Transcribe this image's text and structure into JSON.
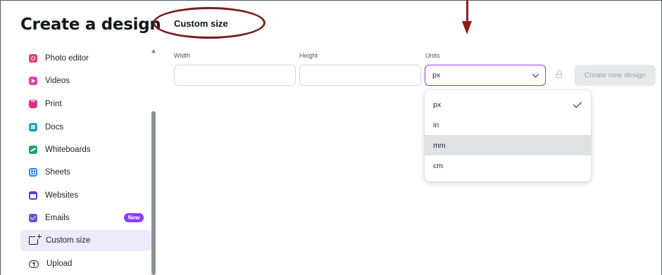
{
  "page": {
    "title": "Create a design"
  },
  "sidebar": {
    "items": [
      {
        "label": "Photo editor",
        "icon": "photo-editor-icon",
        "color": "#e8386f"
      },
      {
        "label": "Videos",
        "icon": "video-icon",
        "color": "#e43ea8"
      },
      {
        "label": "Print",
        "icon": "print-icon",
        "color": "#d8337d"
      },
      {
        "label": "Docs",
        "icon": "docs-icon",
        "color": "#1aa3b5"
      },
      {
        "label": "Whiteboards",
        "icon": "whiteboard-icon",
        "color": "#17a55f"
      },
      {
        "label": "Sheets",
        "icon": "sheets-icon",
        "color": "#2f83e6"
      },
      {
        "label": "Websites",
        "icon": "websites-icon",
        "color": "#5a3fd6"
      },
      {
        "label": "Emails",
        "icon": "email-icon",
        "color": "#5d5bd8",
        "badge": "New"
      },
      {
        "label": "Custom size",
        "icon": "custom-size-icon",
        "color": "#1c2126",
        "active": true
      },
      {
        "label": "Upload",
        "icon": "upload-icon",
        "color": "#1c2126"
      }
    ]
  },
  "custom_size": {
    "title": "Custom size",
    "width_label": "Width",
    "height_label": "Height",
    "units_label": "Units",
    "width_value": "",
    "height_value": "",
    "units_value": "px",
    "create_button": "Create new design"
  },
  "units_dropdown": {
    "options": [
      {
        "label": "px",
        "selected": true
      },
      {
        "label": "in",
        "selected": false
      },
      {
        "label": "mm",
        "selected": false,
        "hovered": true
      },
      {
        "label": "cm",
        "selected": false
      }
    ]
  },
  "colors": {
    "accent": "#8b3dff",
    "annotation": "#7a1c1f",
    "active_bg": "#efe9fb"
  }
}
